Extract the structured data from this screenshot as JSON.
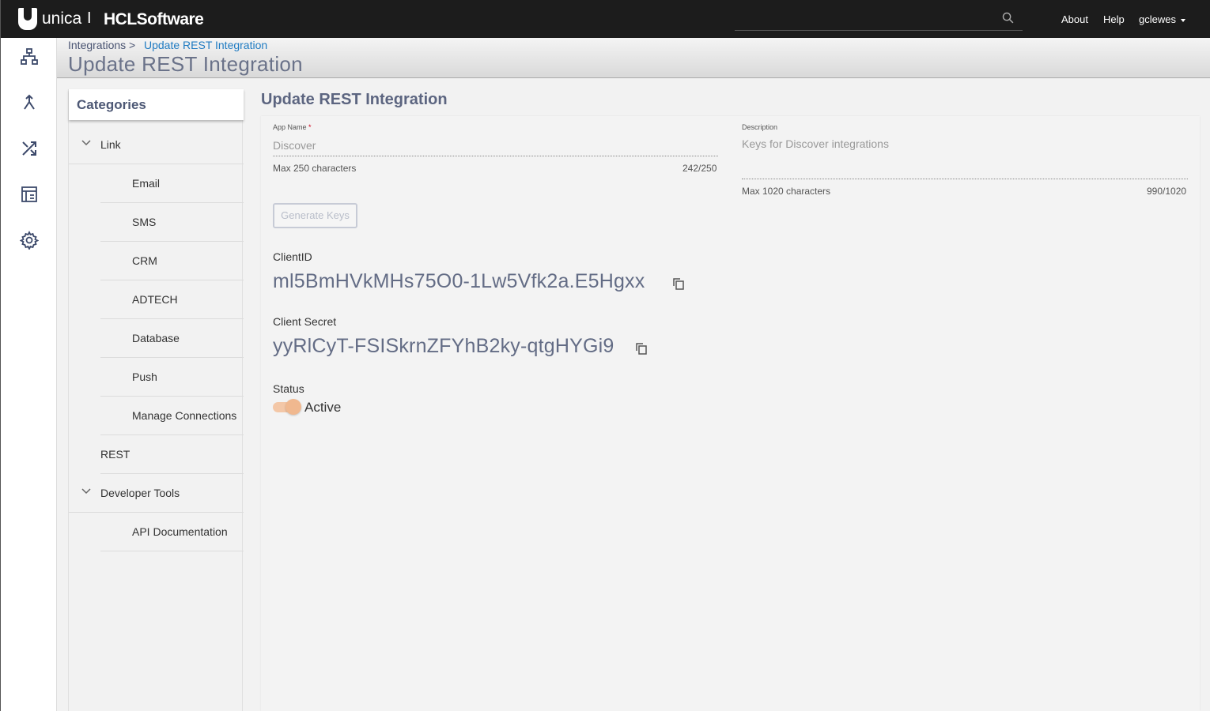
{
  "topbar": {
    "brand_unica": "unica",
    "brand_sep": "I",
    "brand_hcl": "HCLSoftware",
    "about": "About",
    "help": "Help",
    "user": "gclewes"
  },
  "rail": {
    "icons": [
      "hierarchy-icon",
      "merge-icon",
      "shuffle-icon",
      "dashboard-icon",
      "gear-icon"
    ]
  },
  "breadcrumb": {
    "parent": "Integrations",
    "separator": ">",
    "current": "Update REST Integration"
  },
  "page_title": "Update REST Integration",
  "categories": {
    "title": "Categories",
    "items": [
      {
        "label": "Link"
      },
      {
        "label": "Email"
      },
      {
        "label": "SMS"
      },
      {
        "label": "CRM"
      },
      {
        "label": "ADTECH"
      },
      {
        "label": "Database"
      },
      {
        "label": "Push"
      },
      {
        "label": "Manage Connections"
      },
      {
        "label": "REST"
      },
      {
        "label": "Developer Tools"
      },
      {
        "label": "API Documentation"
      }
    ]
  },
  "form": {
    "title": "Update REST Integration",
    "app_name": {
      "label": "App Name",
      "required_mark": "*",
      "value": "Discover",
      "hint": "Max 250 characters",
      "count": "242/250"
    },
    "description": {
      "label": "Description",
      "value": "Keys for Discover integrations",
      "hint": "Max 1020 characters",
      "count": "990/1020"
    },
    "generate_keys_label": "Generate Keys",
    "client_id": {
      "label": "ClientID",
      "value": "ml5BmHVkMHs75O0-1Lw5Vfk2a.E5Hgxx"
    },
    "client_secret": {
      "label": "Client Secret",
      "value": "yyRlCyT-FSISkrnZFYhB2ky-qtgHYGi9"
    },
    "status": {
      "label": "Status",
      "value": "Active"
    }
  },
  "colors": {
    "topbar": "#1c1c1c",
    "title": "#5c6580",
    "link": "#1f7bc2",
    "toggle": "#f0b88f"
  }
}
